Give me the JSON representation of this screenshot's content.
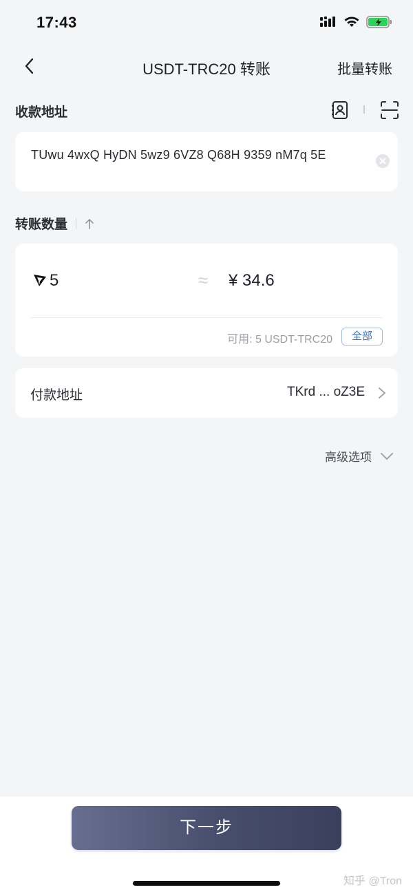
{
  "status_bar": {
    "time": "17:43",
    "icons": [
      "signal-icon",
      "wifi-icon",
      "battery-charging-icon"
    ],
    "battery_color": "#30d158"
  },
  "nav": {
    "back_icon": "chevron-left-icon",
    "title": "USDT-TRC20 转账",
    "right_action": "批量转账"
  },
  "recipient": {
    "label": "收款地址",
    "address": "TUwu 4wxQ HyDN 5wz9 6VZ8 Q68H 9359 nM7q 5E",
    "contacts_icon": "contacts-icon",
    "scan_icon": "scan-icon",
    "clear_icon": "clear-icon"
  },
  "amount": {
    "label": "转账数量",
    "swap_icon": "swap-arrow-up-icon",
    "token_icon": "tron-logo-icon",
    "value": "5",
    "approx_symbol": "≈",
    "fiat_value": "¥ 34.6",
    "available": "可用: 5 USDT-TRC20",
    "all_button": "全部"
  },
  "payer": {
    "label": "付款地址",
    "address": "TKrd ... oZ3E",
    "chevron_icon": "chevron-right-icon"
  },
  "advanced": {
    "label": "高级选项",
    "chevron_icon": "chevron-down-icon"
  },
  "footer": {
    "next_button": "下一步",
    "watermark": "知乎 @Tron"
  },
  "colors": {
    "background": "#f4f5f7",
    "card": "#ffffff",
    "accent_blue": "#3d6fc7",
    "button_gradient_start": "#676f91",
    "button_gradient_end": "#3a405c"
  }
}
